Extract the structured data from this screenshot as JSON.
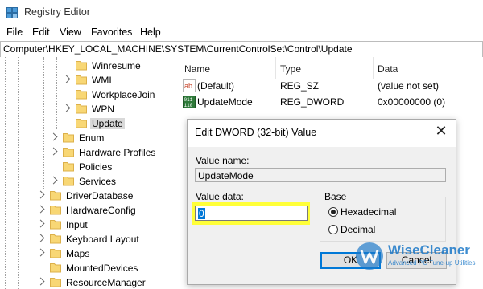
{
  "window": {
    "title": "Registry Editor"
  },
  "menu": [
    "File",
    "Edit",
    "View",
    "Favorites",
    "Help"
  ],
  "address": "Computer\\HKEY_LOCAL_MACHINE\\SYSTEM\\CurrentControlSet\\Control\\Update",
  "tree": {
    "items": [
      {
        "label": "Winresume"
      },
      {
        "label": "WMI"
      },
      {
        "label": "WorkplaceJoin"
      },
      {
        "label": "WPN"
      },
      {
        "label": "Update",
        "selected": true
      },
      {
        "label": "Enum"
      },
      {
        "label": "Hardware Profiles"
      },
      {
        "label": "Policies"
      },
      {
        "label": "Services"
      },
      {
        "label": "DriverDatabase"
      },
      {
        "label": "HardwareConfig"
      },
      {
        "label": "Input"
      },
      {
        "label": "Keyboard Layout"
      },
      {
        "label": "Maps"
      },
      {
        "label": "MountedDevices"
      },
      {
        "label": "ResourceManager"
      }
    ]
  },
  "list": {
    "headers": [
      "Name",
      "Type",
      "Data"
    ],
    "rows": [
      {
        "name": "(Default)",
        "type": "REG_SZ",
        "data": "(value not set)",
        "icon": "string-value-icon"
      },
      {
        "name": "UpdateMode",
        "type": "REG_DWORD",
        "data": "0x00000000 (0)",
        "icon": "dword-value-icon"
      }
    ]
  },
  "dialog": {
    "title": "Edit DWORD (32-bit) Value",
    "value_name_label": "Value name:",
    "value_name": "UpdateMode",
    "value_data_label": "Value data:",
    "value_data": "0",
    "base_label": "Base",
    "hex_label": "Hexadecimal",
    "dec_label": "Decimal",
    "base_selected": "Hexadecimal",
    "ok_label": "OK",
    "cancel_label": "Cancel",
    "close_glyph": "✕"
  },
  "watermark": {
    "name": "WiseCleaner",
    "tagline": "Advanced PC Tune-up Utilities"
  },
  "colors": {
    "highlight": "#ffff38",
    "folder": "#f8d775",
    "accent": "#0078d7"
  }
}
